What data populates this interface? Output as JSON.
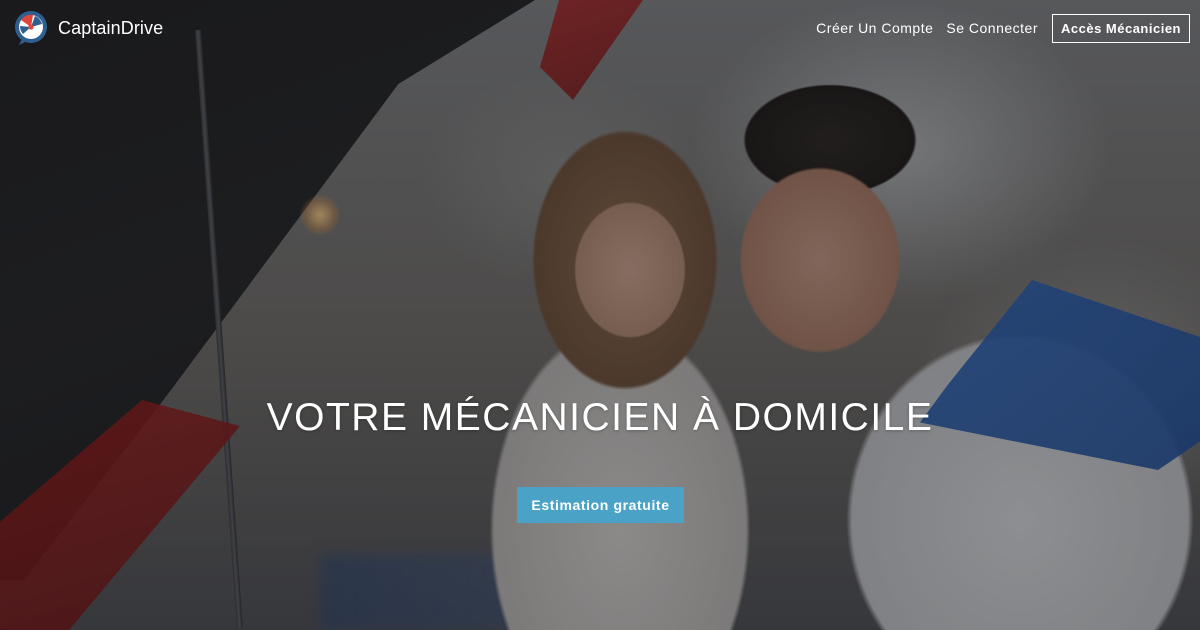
{
  "brand": {
    "name": "CaptainDrive",
    "logo_icon": "captaindrive-logo-icon"
  },
  "nav": {
    "create_account": "Créer Un Compte",
    "login": "Se Connecter",
    "mechanic_access": "Accès Mécanicien"
  },
  "hero": {
    "title": "VOTRE MÉCANICIEN À DOMICILE",
    "cta_label": "Estimation gratuite",
    "background": "photo-mechanic-and-customer-under-car-hood"
  },
  "colors": {
    "cta": "#4aa3c7",
    "logo_red": "#e0453b",
    "logo_blue": "#2f5f8f"
  }
}
